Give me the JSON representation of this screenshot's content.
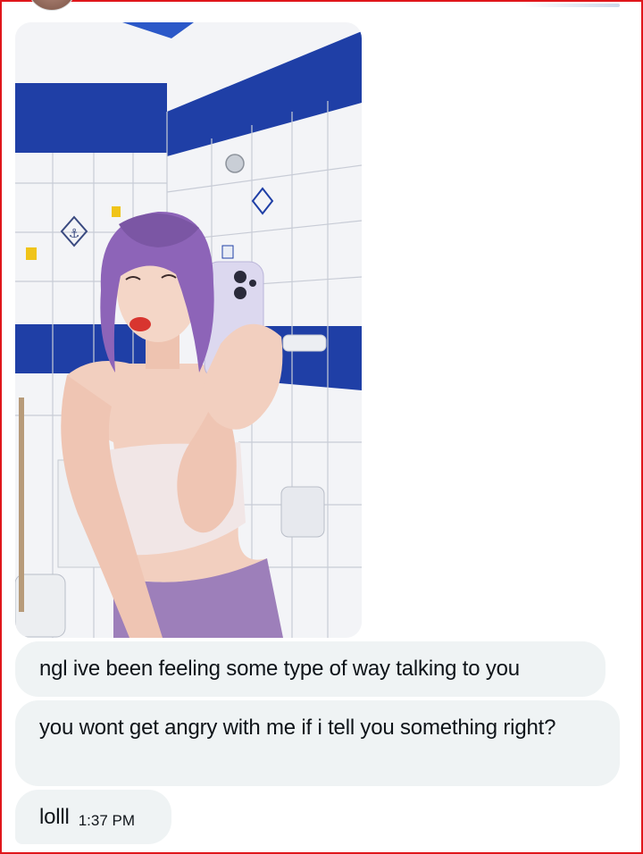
{
  "conversation": {
    "messages": [
      {
        "text": "ngl ive been feeling some type of way talking to you"
      },
      {
        "text": "you wont get angry with me if i tell you something right?"
      },
      {
        "text": "lolll",
        "timestamp": "1:37 PM"
      }
    ]
  },
  "media": {
    "icon": "photo-attachment",
    "colors": {
      "tile_white": "#f3f4f7",
      "tile_blue": "#1f3fa6",
      "hair": "#8d64b8",
      "top": "#f1e6e6",
      "pants": "#9d7fba",
      "skin": "#f2cfbf",
      "phone": "#dcd8ef"
    }
  },
  "theme": {
    "bubble_bg": "#eff3f4",
    "text": "#0f1419",
    "border": "#e0161b"
  }
}
